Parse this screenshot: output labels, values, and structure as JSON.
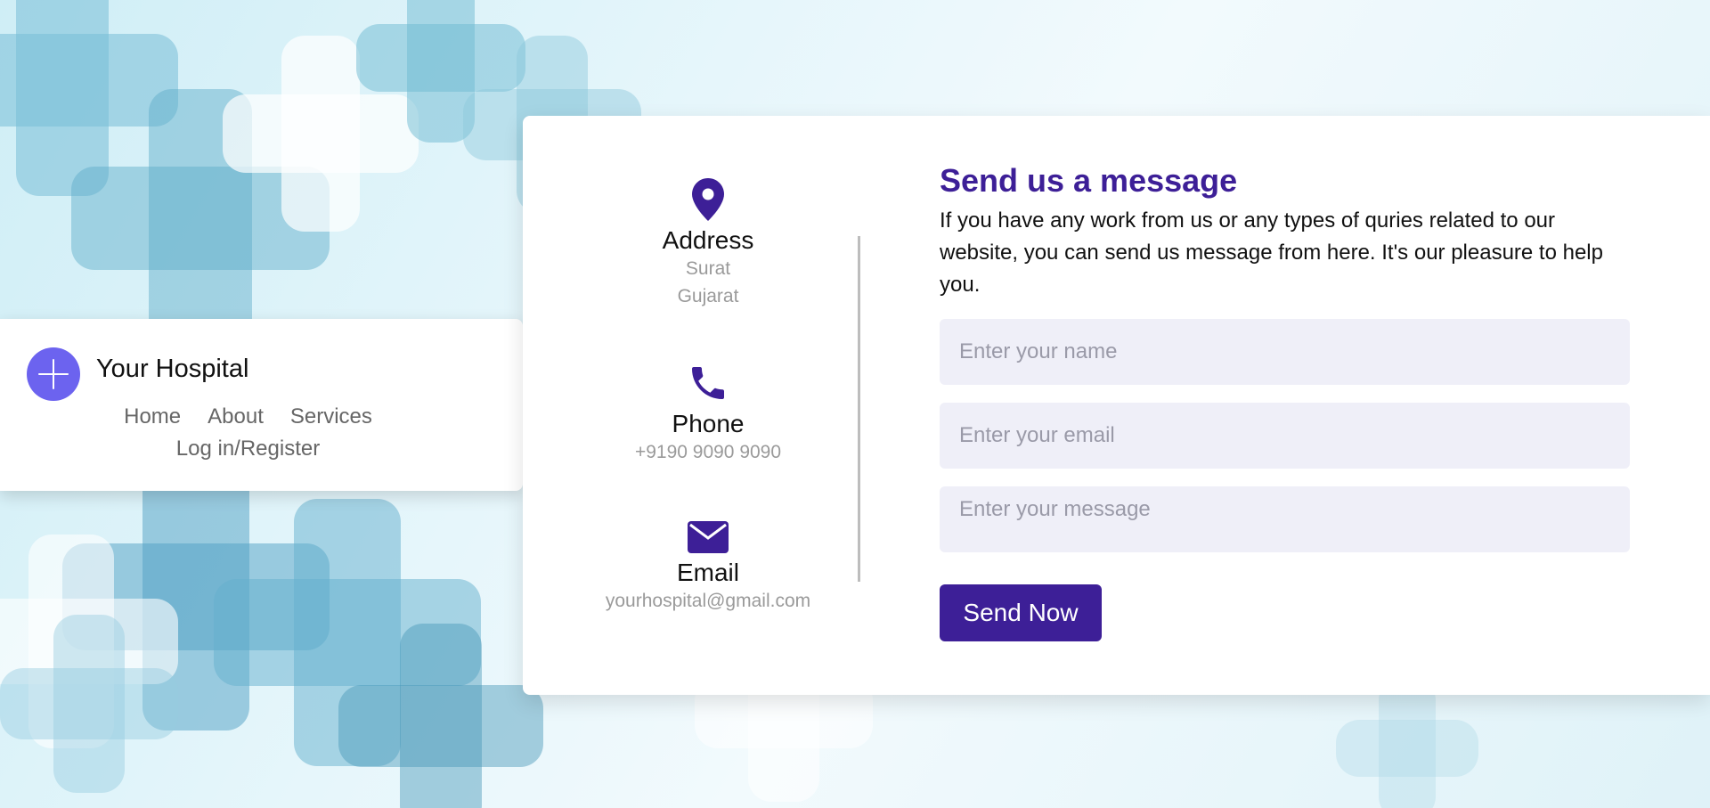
{
  "brand": {
    "name": "Your Hospital",
    "logo_icon": "plus-icon",
    "logo_color": "#6c63ef"
  },
  "nav": {
    "links": [
      "Home",
      "About",
      "Services"
    ],
    "auth": "Log in/Register"
  },
  "contact": {
    "address": {
      "icon": "location-pin-icon",
      "title": "Address",
      "line1": "Surat",
      "line2": "Gujarat"
    },
    "phone": {
      "icon": "phone-icon",
      "title": "Phone",
      "value": "+9190 9090 9090"
    },
    "email": {
      "icon": "envelope-icon",
      "title": "Email",
      "value": "yourhospital@gmail.com"
    }
  },
  "form": {
    "heading": "Send us a message",
    "description": "If you have any work from us or any types of quries related to our website, you can send us message from here. It's our pleasure to help you.",
    "name_placeholder": "Enter your name",
    "email_placeholder": "Enter your email",
    "message_placeholder": "Enter your message",
    "submit_label": "Send Now"
  },
  "colors": {
    "accent": "#3d1f97",
    "field_bg": "#efeff8"
  }
}
